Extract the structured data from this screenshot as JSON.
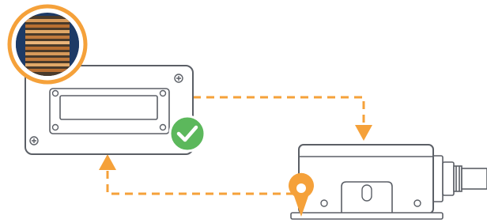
{
  "diagram": {
    "colors": {
      "accent": "#f5a13a",
      "outline": "#5b5f66",
      "fill": "#ffffff",
      "badge_navy": "#1d3a66",
      "copper": "#c07a3d",
      "check_green": "#5cb85c"
    },
    "elements": {
      "left_panel": "mounting-plate",
      "zoom_badge": "copper-coil-closeup",
      "status_badge": "check-icon",
      "right_device": "sensor-housing",
      "location_marker": "map-pin-icon",
      "flow": [
        "dashed-connector-top",
        "arrowhead-down",
        "dashed-connector-bottom",
        "arrowhead-up"
      ]
    }
  }
}
